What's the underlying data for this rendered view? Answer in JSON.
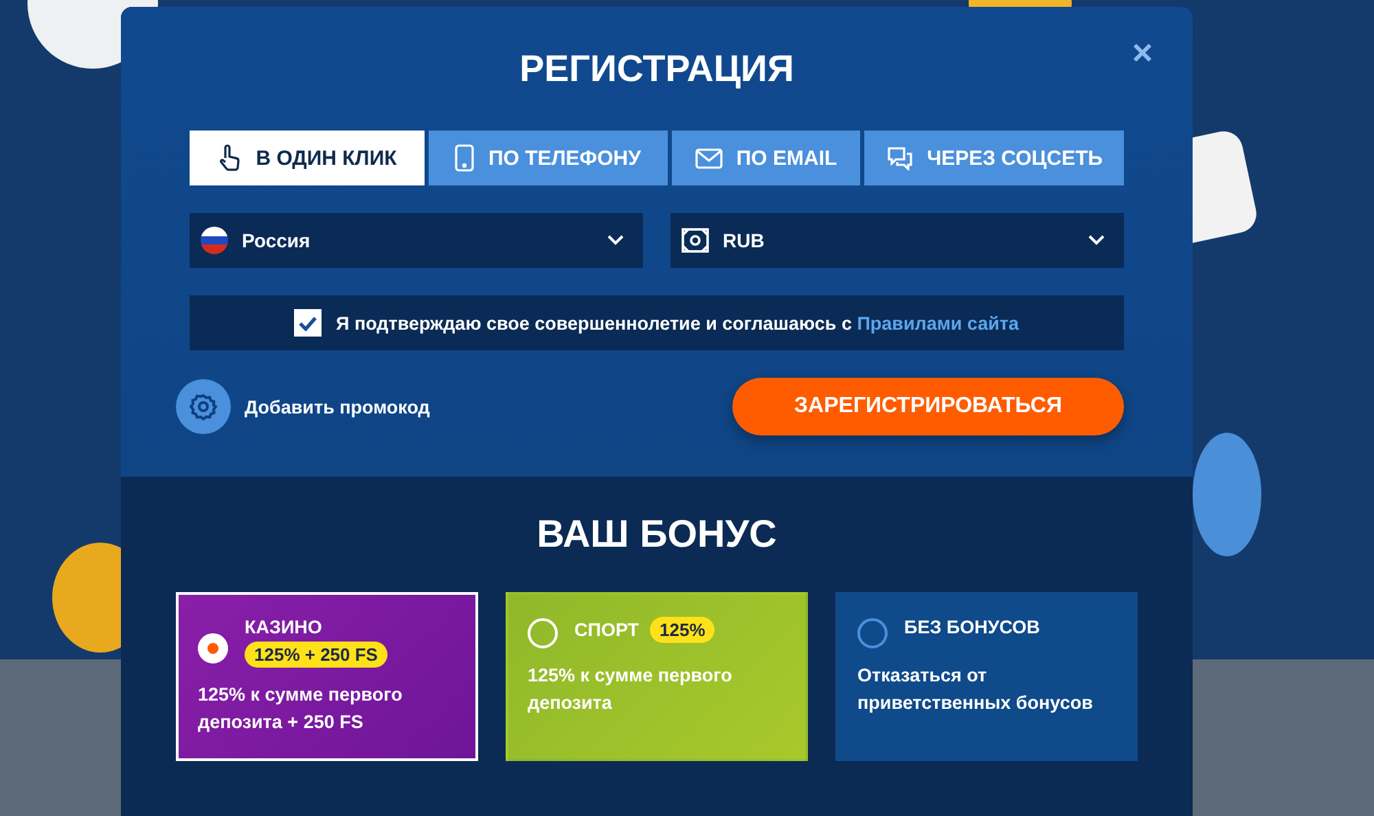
{
  "modal": {
    "title": "РЕГИСТРАЦИЯ",
    "close": "×"
  },
  "tabs": [
    {
      "label": "В ОДИН КЛИК",
      "kind": "hand",
      "selected": true
    },
    {
      "label": "ПО ТЕЛЕФОНУ",
      "kind": "phone",
      "selected": false
    },
    {
      "label": "ПО EMAIL",
      "kind": "mail",
      "selected": false
    },
    {
      "label": "ЧЕРЕЗ СОЦСЕТЬ",
      "kind": "chat",
      "selected": false
    }
  ],
  "country_select": {
    "value": "Россия"
  },
  "currency_select": {
    "value": "RUB"
  },
  "agreement": {
    "checked": true,
    "text": "Я подтверждаю свое совершеннолетие и соглашаюсь с",
    "link": "Правилами сайта"
  },
  "promo": {
    "label": "Добавить промокод"
  },
  "register_button": "ЗАРЕГИСТРИРОВАТЬСЯ",
  "bonus": {
    "title": "ВАШ БОНУС",
    "cards": [
      {
        "kind": "casino",
        "title": "КАЗИНО",
        "badge": "125% + 250 FS",
        "text": "125% к сумме первого депозита + 250 FS",
        "selected": true
      },
      {
        "kind": "sport",
        "title": "СПОРТ",
        "badge": "125%",
        "text": "125% к сумме первого депозита",
        "selected": false
      },
      {
        "kind": "none",
        "title": "БЕЗ БОНУСОВ",
        "text": "Отказаться от приветственных бонусов",
        "selected": false
      }
    ]
  }
}
